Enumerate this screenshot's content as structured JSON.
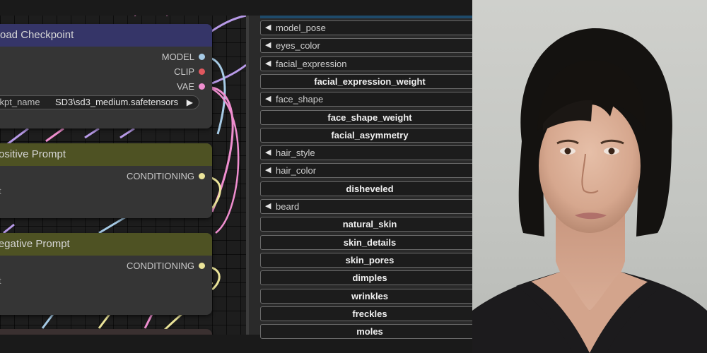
{
  "nodes": {
    "load_checkpoint": {
      "title": "oad Checkpoint",
      "outputs": [
        "MODEL",
        "CLIP",
        "VAE"
      ],
      "ckpt_label": "ckpt_name",
      "ckpt_value": "SD3\\sd3_medium.safetensors"
    },
    "positive_prompt": {
      "title": "Positive Prompt",
      "output": "CONDITIONING",
      "input_fragment": "t"
    },
    "negative_prompt": {
      "title": "Negative Prompt",
      "output": "CONDITIONING",
      "input_fragment": "t"
    }
  },
  "panel": {
    "fields": [
      {
        "label": "model_pose",
        "kind": "combo"
      },
      {
        "label": "eyes_color",
        "kind": "combo"
      },
      {
        "label": "facial_expression",
        "kind": "combo"
      },
      {
        "label": "facial_expression_weight",
        "kind": "number"
      },
      {
        "label": "face_shape",
        "kind": "combo"
      },
      {
        "label": "face_shape_weight",
        "kind": "number"
      },
      {
        "label": "facial_asymmetry",
        "kind": "number"
      },
      {
        "label": "hair_style",
        "kind": "combo"
      },
      {
        "label": "hair_color",
        "kind": "combo"
      },
      {
        "label": "disheveled",
        "kind": "number"
      },
      {
        "label": "beard",
        "kind": "combo"
      },
      {
        "label": "natural_skin",
        "kind": "number"
      },
      {
        "label": "skin_details",
        "kind": "number"
      },
      {
        "label": "skin_pores",
        "kind": "number"
      },
      {
        "label": "dimples",
        "kind": "number"
      },
      {
        "label": "wrinkles",
        "kind": "number"
      },
      {
        "label": "freckles",
        "kind": "number"
      },
      {
        "label": "moles",
        "kind": "number"
      }
    ]
  },
  "colors": {
    "checkpoint_title": "#353568",
    "prompt_title": "#4e5223",
    "model_socket": "#a6cbe6",
    "clip_socket": "#e0585f",
    "vae_socket": "#ef8ecf",
    "conditioning_socket": "#ece59a"
  },
  "icons": {
    "combo_arrow": "triangle-left-icon",
    "widget_arrow": "triangle-right-icon"
  }
}
